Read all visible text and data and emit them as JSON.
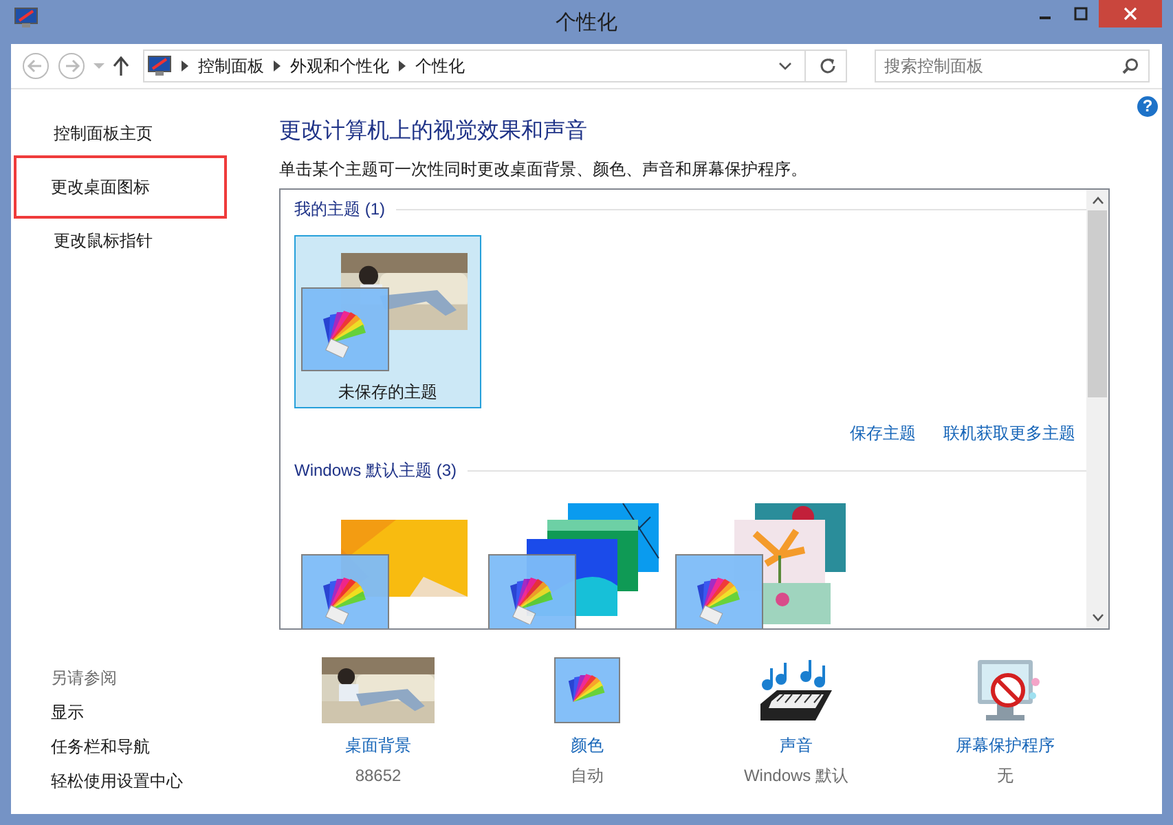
{
  "window": {
    "title": "个性化"
  },
  "nav": {
    "breadcrumb": [
      "控制面板",
      "外观和个性化",
      "个性化"
    ],
    "search": {
      "placeholder": "搜索控制面板"
    },
    "help": "?"
  },
  "sidebar": {
    "items": [
      {
        "label": "控制面板主页",
        "highlighted": false
      },
      {
        "label": "更改桌面图标",
        "highlighted": true
      },
      {
        "label": "更改鼠标指针",
        "highlighted": false
      }
    ],
    "see_also": {
      "title": "另请参阅",
      "links": [
        "显示",
        "任务栏和导航",
        "轻松使用设置中心"
      ]
    }
  },
  "main": {
    "heading": "更改计算机上的视觉效果和声音",
    "description": "单击某个主题可一次性同时更改桌面背景、颜色、声音和屏幕保护程序。",
    "groups": [
      {
        "title": "我的主题 (1)",
        "actions": [
          "保存主题",
          "联机获取更多主题"
        ],
        "themes": [
          {
            "name": "未保存的主题",
            "selected": true
          }
        ]
      },
      {
        "title": "Windows 默认主题 (3)",
        "themes": [
          {
            "kind": "yellow",
            "selected": false
          },
          {
            "kind": "blue",
            "selected": false
          },
          {
            "kind": "flower",
            "selected": false
          }
        ]
      }
    ]
  },
  "settings": [
    {
      "label": "桌面背景",
      "value": "88652"
    },
    {
      "kind": "color",
      "label": "颜色",
      "value": "自动"
    },
    {
      "kind": "sound",
      "label": "声音",
      "value": "Windows 默认"
    },
    {
      "kind": "screensaver",
      "label": "屏幕保护程序",
      "value": "无"
    }
  ]
}
